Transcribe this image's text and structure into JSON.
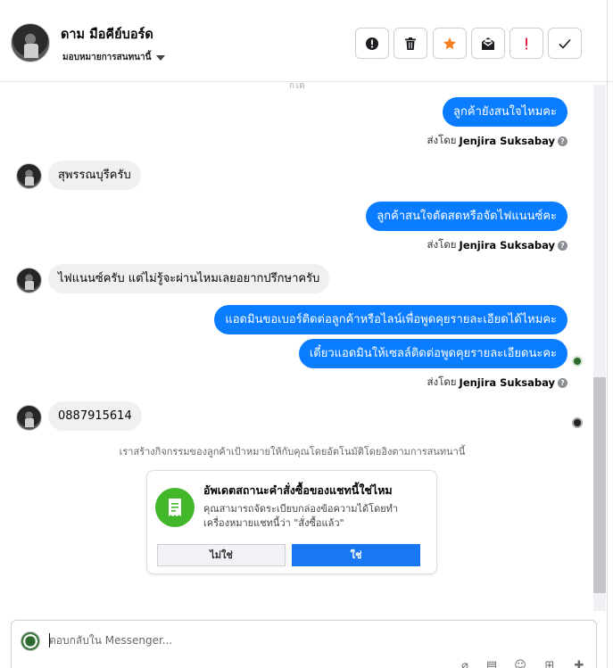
{
  "header": {
    "contact_name": "ดาม มือคีย์บอร์ด",
    "assign_label": "มอบหมายการสนทนานี้",
    "actions": [
      {
        "name": "spam-icon",
        "color": "#1c1e21"
      },
      {
        "name": "trash-icon",
        "color": "#1c1e21"
      },
      {
        "name": "star-icon",
        "color": "#f5821f"
      },
      {
        "name": "mark-unread-icon",
        "color": "#1c1e21"
      },
      {
        "name": "follow-up-icon",
        "color": "#e41e3f"
      },
      {
        "name": "check-done-icon",
        "color": "#1c1e21"
      }
    ]
  },
  "messages": {
    "top_fragment": "ก็ได้",
    "out_1": "ลูกค้ายังสนใจไหมคะ",
    "in_1": "สุพรรณบุรีครับ",
    "out_2": "ลูกค้าสนใจตัดสดหรือจัดไฟแนนซ์คะ",
    "in_2": "ไฟแนนซ์ครับ แต่ไม่รู้จะผ่านไหมเลยอยากปรึกษาครับ",
    "out_3": "แอดมินขอเบอร์ติดต่อลูกค้าหรือไลน์เพื่อพูดคุยรายละเอียดได้ไหมคะ",
    "out_4": "เดี๋ยวแอดมินให้เซลล์ติดต่อพูดคุยรายละเอียดนะคะ",
    "in_3": "0887915614",
    "sent_by_prefix": "ส่งโดย",
    "sent_by_name": "Jenjira Suksabay",
    "help_mark": "?"
  },
  "system_note": "เราสร้างกิจกรรมของลูกค้าเป้าหมายให้กับคุณโดยอัตโนมัติโดยอิงตามการสนทนานี้",
  "card": {
    "title": "อัพเดตสถานะคำสั่งซื้อของแชทนี้ใช่ไหม",
    "description": "คุณสามารถจัดระเบียบกล่องข้อความได้โดยทำเครื่องหมายแชทนี้ว่า \"สั่งซื้อแล้ว\"",
    "no_label": "ไม่ใช่",
    "yes_label": "ใช่",
    "accent": "#42b72a"
  },
  "composer": {
    "placeholder": "ตอบกลับใน Messenger...",
    "value": ""
  },
  "colors": {
    "outgoing_bubble": "#0a7cff",
    "incoming_bubble": "#f0f0f0",
    "primary_button": "#1877f2"
  }
}
